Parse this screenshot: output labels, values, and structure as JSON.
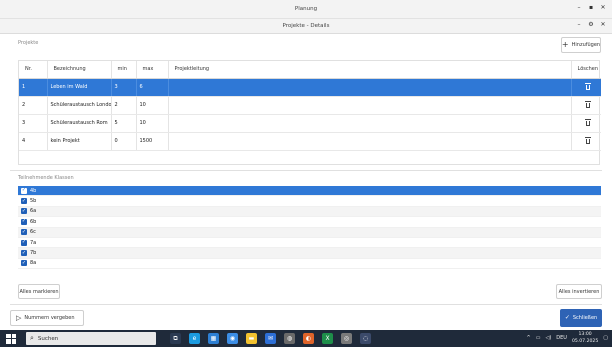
{
  "window": {
    "outer_title": "Planung",
    "inner_title": "Projekte - Details",
    "outer_controls": [
      "–",
      "▪",
      "✕"
    ],
    "inner_controls": [
      "–",
      "⚙",
      "✕"
    ]
  },
  "projects": {
    "section_label": "Projekte",
    "add_label": "Hinzufügen",
    "columns": [
      "Nr.",
      "Bezeichnung",
      "min",
      "max",
      "Projektleitung",
      "Löschen"
    ],
    "rows": [
      {
        "nr": "1",
        "name": "Leben im Wald",
        "min": "3",
        "max": "6",
        "lead": "",
        "selected": true
      },
      {
        "nr": "2",
        "name": "Schüleraustausch London",
        "min": "2",
        "max": "10",
        "lead": "",
        "selected": false
      },
      {
        "nr": "3",
        "name": "Schüleraustausch Rom",
        "min": "5",
        "max": "10",
        "lead": "",
        "selected": false
      },
      {
        "nr": "4",
        "name": "kein Projekt",
        "min": "0",
        "max": "1500",
        "lead": "",
        "selected": false
      }
    ]
  },
  "classes": {
    "section_label": "Teilnehmende Klassen",
    "items": [
      {
        "label": "4b",
        "checked": true,
        "selected": true
      },
      {
        "label": "5b",
        "checked": true,
        "selected": false
      },
      {
        "label": "6a",
        "checked": true,
        "selected": false
      },
      {
        "label": "6b",
        "checked": true,
        "selected": false
      },
      {
        "label": "6c",
        "checked": true,
        "selected": false
      },
      {
        "label": "7a",
        "checked": true,
        "selected": false
      },
      {
        "label": "7b",
        "checked": true,
        "selected": false
      },
      {
        "label": "8a",
        "checked": true,
        "selected": false
      }
    ],
    "mark_all_label": "Alles markieren",
    "invert_label": "Alles invertieren"
  },
  "footer": {
    "assign_numbers_label": "Nummern vergeben",
    "close_label": "Schließen"
  },
  "taskbar": {
    "search_placeholder": "Suchen",
    "apps": [
      {
        "icon": "task-view-icon",
        "color": "#2b3a52",
        "glyph": "⧉"
      },
      {
        "icon": "edge-icon",
        "color": "#1b9be0",
        "glyph": "e"
      },
      {
        "icon": "store-icon",
        "color": "#2d7fd3",
        "glyph": "▦"
      },
      {
        "icon": "chrome-icon",
        "color": "#3c8ee6",
        "glyph": "◉"
      },
      {
        "icon": "explorer-icon",
        "color": "#f2c230",
        "glyph": "▬"
      },
      {
        "icon": "mail-icon",
        "color": "#2d6fd6",
        "glyph": "✉"
      },
      {
        "icon": "app-icon",
        "color": "#6a6a6a",
        "glyph": "◍"
      },
      {
        "icon": "firefox-icon",
        "color": "#e0642a",
        "glyph": "◐"
      },
      {
        "icon": "excel-icon",
        "color": "#1e8f4a",
        "glyph": "X"
      },
      {
        "icon": "app2-icon",
        "color": "#7a7a7a",
        "glyph": "◎"
      },
      {
        "icon": "app3-icon",
        "color": "#3b4a6a",
        "glyph": "◌"
      }
    ],
    "lang": "DEU",
    "time": "13:00",
    "date": "05.07.2025"
  }
}
